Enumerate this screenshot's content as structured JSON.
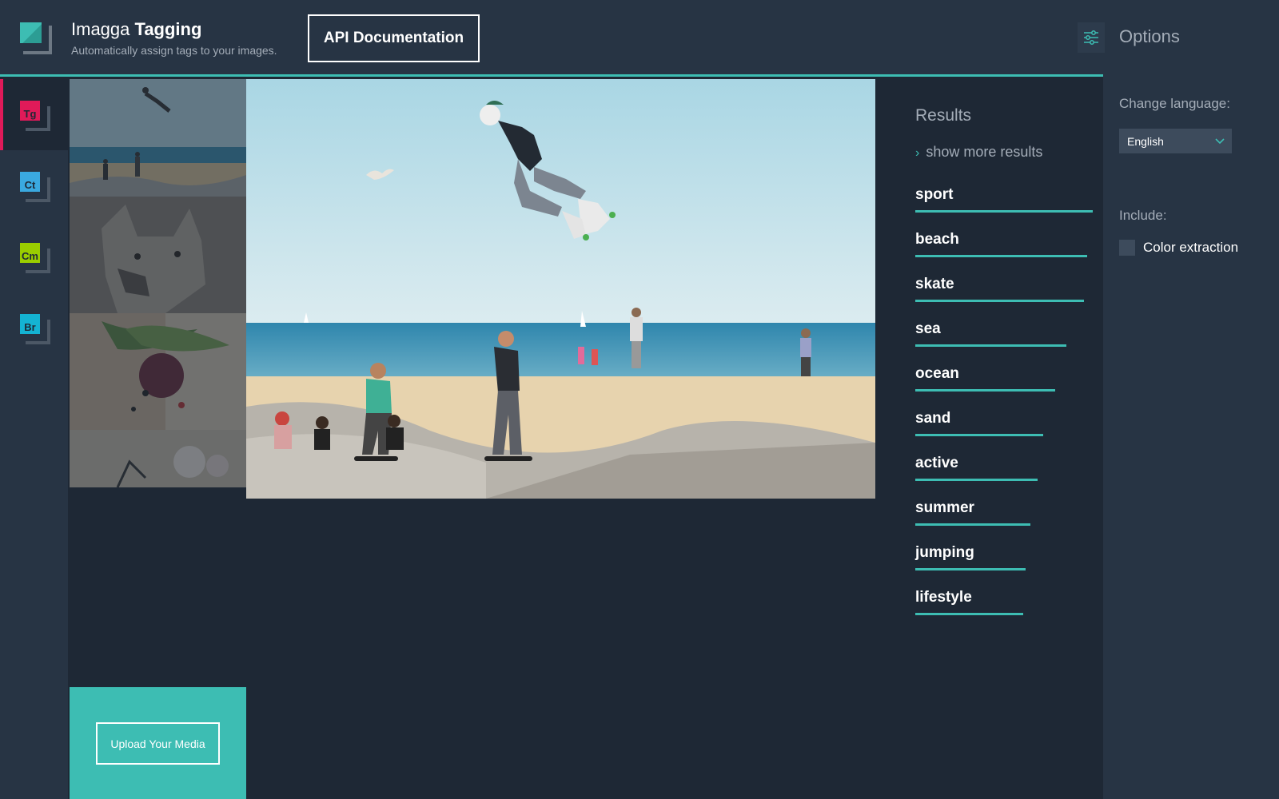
{
  "header": {
    "brand_light": "Imagga",
    "brand_bold": "Tagging",
    "subtitle": "Automatically assign tags to your images.",
    "api_button": "API Documentation"
  },
  "nav": {
    "items": [
      {
        "code": "Tg",
        "color": "#e01a59",
        "active": true
      },
      {
        "code": "Ct",
        "color": "#3aa9e0",
        "active": false
      },
      {
        "code": "Cm",
        "color": "#9acd00",
        "active": false
      },
      {
        "code": "Br",
        "color": "#14b3d3",
        "active": false
      }
    ]
  },
  "upload": {
    "label": "Upload Your Media"
  },
  "results": {
    "title": "Results",
    "show_more": "show more results",
    "tags": [
      {
        "label": "sport",
        "confidence": 1.0
      },
      {
        "label": "beach",
        "confidence": 0.97
      },
      {
        "label": "skate",
        "confidence": 0.95
      },
      {
        "label": "sea",
        "confidence": 0.85
      },
      {
        "label": "ocean",
        "confidence": 0.79
      },
      {
        "label": "sand",
        "confidence": 0.72
      },
      {
        "label": "active",
        "confidence": 0.69
      },
      {
        "label": "summer",
        "confidence": 0.65
      },
      {
        "label": "jumping",
        "confidence": 0.62
      },
      {
        "label": "lifestyle",
        "confidence": 0.61
      }
    ]
  },
  "options": {
    "title": "Options",
    "language_label": "Change language:",
    "language_value": "English",
    "include_label": "Include:",
    "color_extraction_label": "Color extraction",
    "color_extraction_checked": false
  },
  "colors": {
    "accent": "#3dbdb3",
    "background": "#1e2835",
    "panel": "#273444"
  }
}
